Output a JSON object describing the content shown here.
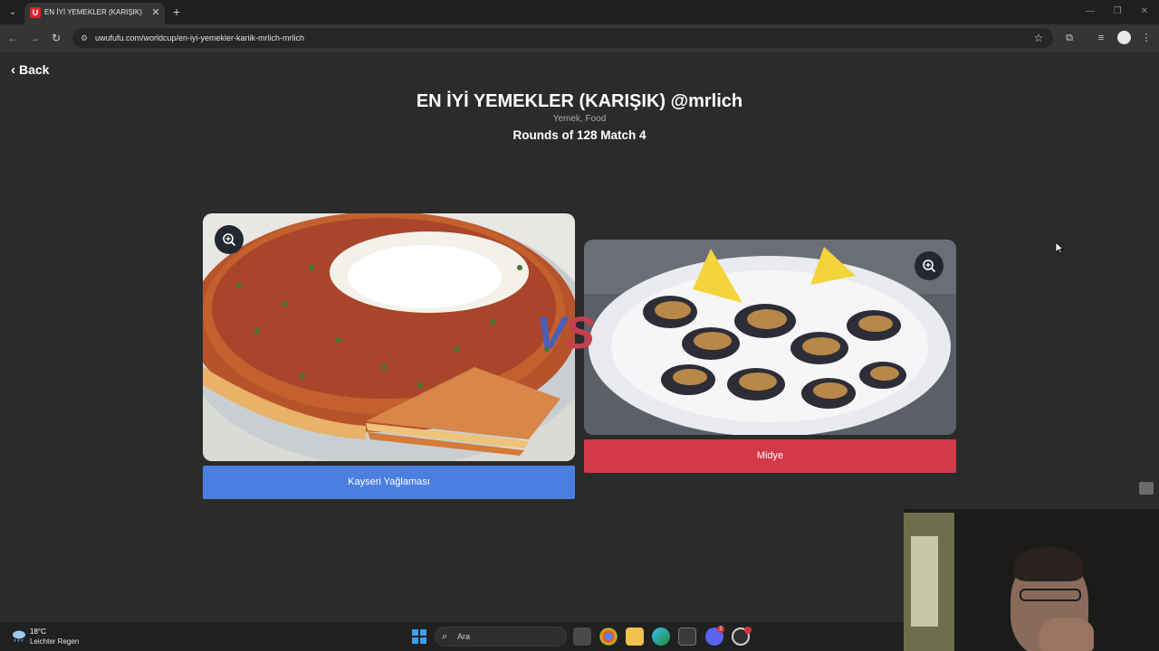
{
  "browser": {
    "tab_title": "EN İYİ YEMEKLER (KARIŞIK) @mrlich",
    "tab_favicon_letter": "U",
    "url": "uwufufu.com/worldcup/en-iyi-yemekler-kariik-mrlich-mrlich"
  },
  "page": {
    "back_label": "Back",
    "title": "EN İYİ YEMEKLER (KARIŞIK) @mrlich",
    "subtitle": "Yemek, Food",
    "round_info": "Rounds of 128 Match 4",
    "vs_text": "VS",
    "left_choice": {
      "label": "Kayseri Yağlaması",
      "button_color": "#4a7fe0"
    },
    "right_choice": {
      "label": "Midye",
      "button_color": "#d33a49"
    }
  },
  "taskbar": {
    "weather_temp": "18°C",
    "weather_desc": "Leichter Regen",
    "search_placeholder": "Ara",
    "messenger_badge": "2"
  }
}
